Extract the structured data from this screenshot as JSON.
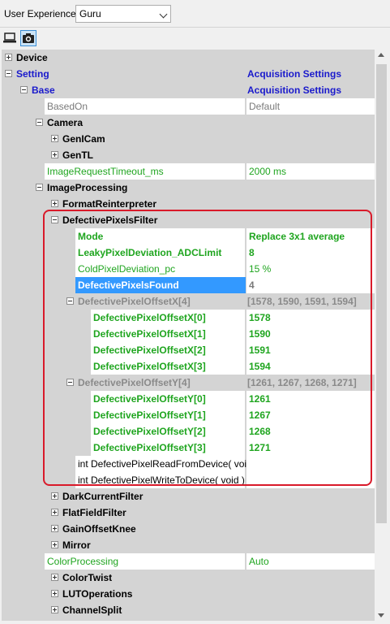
{
  "toolbar": {
    "user_experience_label": "User Experience:",
    "user_experience_value": "Guru"
  },
  "tabs": [
    {
      "icon": "laptop-icon"
    },
    {
      "icon": "camera-icon",
      "active": true
    }
  ],
  "rows": [
    {
      "name": "Device",
      "value": "",
      "indent": 0,
      "exp": "plus",
      "style": "bold"
    },
    {
      "name": "Setting",
      "value": "Acquisition Settings",
      "indent": 0,
      "exp": "minus",
      "style": "grouptitle"
    },
    {
      "name": "Base",
      "value": "Acquisition Settings",
      "indent": 1,
      "exp": "minus",
      "style": "grouptitle"
    },
    {
      "name": "BasedOn",
      "value": "Default",
      "indent": 2,
      "exp": "",
      "style": "white",
      "nameColor": "#7a7a7a",
      "valueColor": "#7a7a7a"
    },
    {
      "name": "Camera",
      "value": "",
      "indent": 2,
      "exp": "minus",
      "style": "bold"
    },
    {
      "name": "GenICam",
      "value": "",
      "indent": 3,
      "exp": "plus",
      "style": "bold"
    },
    {
      "name": "GenTL",
      "value": "",
      "indent": 3,
      "exp": "plus",
      "style": "bold"
    },
    {
      "name": "ImageRequestTimeout_ms",
      "value": "2000 ms",
      "indent": 2,
      "exp": "",
      "style": "white",
      "nameColor": "#1fa51f",
      "valueColor": "#1fa51f"
    },
    {
      "name": "ImageProcessing",
      "value": "",
      "indent": 2,
      "exp": "minus",
      "style": "bold"
    },
    {
      "name": "FormatReinterpreter",
      "value": "",
      "indent": 3,
      "exp": "plus",
      "style": "bold"
    },
    {
      "name": "DefectivePixelsFilter",
      "value": "",
      "indent": 3,
      "exp": "minus",
      "style": "bold"
    },
    {
      "name": "Mode",
      "value": "Replace 3x1 average",
      "indent": 4,
      "exp": "",
      "style": "white bold",
      "nameColor": "#1fa51f",
      "valueColor": "#1fa51f"
    },
    {
      "name": "LeakyPixelDeviation_ADCLimit",
      "value": "8",
      "indent": 4,
      "exp": "",
      "style": "white bold",
      "nameColor": "#1fa51f",
      "valueColor": "#1fa51f"
    },
    {
      "name": "ColdPixelDeviation_pc",
      "value": "15 %",
      "indent": 4,
      "exp": "",
      "style": "white",
      "nameColor": "#1fa51f",
      "valueColor": "#1fa51f"
    },
    {
      "name": "DefectivePixelsFound",
      "value": "4",
      "indent": 4,
      "exp": "",
      "style": "selected bold",
      "valueColor": "#7a7a7a"
    },
    {
      "name": "DefectivePixelOffsetX[4]",
      "value": "[1578, 1590, 1591, 1594]",
      "indent": 4,
      "exp": "minus",
      "style": "bold",
      "nameColor": "#8a8a8a",
      "valueColor": "#8a8a8a"
    },
    {
      "name": "DefectivePixelOffsetX[0]",
      "value": "1578",
      "indent": 5,
      "exp": "",
      "style": "white bold",
      "nameColor": "#1fa51f",
      "valueColor": "#1fa51f"
    },
    {
      "name": "DefectivePixelOffsetX[1]",
      "value": "1590",
      "indent": 5,
      "exp": "",
      "style": "white bold",
      "nameColor": "#1fa51f",
      "valueColor": "#1fa51f"
    },
    {
      "name": "DefectivePixelOffsetX[2]",
      "value": "1591",
      "indent": 5,
      "exp": "",
      "style": "white bold",
      "nameColor": "#1fa51f",
      "valueColor": "#1fa51f"
    },
    {
      "name": "DefectivePixelOffsetX[3]",
      "value": "1594",
      "indent": 5,
      "exp": "",
      "style": "white bold",
      "nameColor": "#1fa51f",
      "valueColor": "#1fa51f"
    },
    {
      "name": "DefectivePixelOffsetY[4]",
      "value": "[1261, 1267, 1268, 1271]",
      "indent": 4,
      "exp": "minus",
      "style": "bold",
      "nameColor": "#8a8a8a",
      "valueColor": "#8a8a8a"
    },
    {
      "name": "DefectivePixelOffsetY[0]",
      "value": "1261",
      "indent": 5,
      "exp": "",
      "style": "white bold",
      "nameColor": "#1fa51f",
      "valueColor": "#1fa51f"
    },
    {
      "name": "DefectivePixelOffsetY[1]",
      "value": "1267",
      "indent": 5,
      "exp": "",
      "style": "white bold",
      "nameColor": "#1fa51f",
      "valueColor": "#1fa51f"
    },
    {
      "name": "DefectivePixelOffsetY[2]",
      "value": "1268",
      "indent": 5,
      "exp": "",
      "style": "white bold",
      "nameColor": "#1fa51f",
      "valueColor": "#1fa51f"
    },
    {
      "name": "DefectivePixelOffsetY[3]",
      "value": "1271",
      "indent": 5,
      "exp": "",
      "style": "white bold",
      "nameColor": "#1fa51f",
      "valueColor": "#1fa51f"
    },
    {
      "name": "int DefectivePixelReadFromDevice( void )",
      "value": "",
      "indent": 4,
      "exp": "",
      "style": "white"
    },
    {
      "name": "int DefectivePixelWriteToDevice( void )",
      "value": "",
      "indent": 4,
      "exp": "",
      "style": "white"
    },
    {
      "name": "DarkCurrentFilter",
      "value": "",
      "indent": 3,
      "exp": "plus",
      "style": "bold"
    },
    {
      "name": "FlatFieldFilter",
      "value": "",
      "indent": 3,
      "exp": "plus",
      "style": "bold"
    },
    {
      "name": "GainOffsetKnee",
      "value": "",
      "indent": 3,
      "exp": "plus",
      "style": "bold"
    },
    {
      "name": "Mirror",
      "value": "",
      "indent": 3,
      "exp": "plus",
      "style": "bold"
    },
    {
      "name": "ColorProcessing",
      "value": "Auto",
      "indent": 2,
      "exp": "",
      "style": "white",
      "nameColor": "#1fa51f",
      "valueColor": "#1fa51f"
    },
    {
      "name": "ColorTwist",
      "value": "",
      "indent": 3,
      "exp": "plus",
      "style": "bold"
    },
    {
      "name": "LUTOperations",
      "value": "",
      "indent": 3,
      "exp": "plus",
      "style": "bold"
    },
    {
      "name": "ChannelSplit",
      "value": "",
      "indent": 3,
      "exp": "plus",
      "style": "bold"
    }
  ],
  "colors": {
    "selected_bg": "#3399ff",
    "highlight_border": "#d91a2a",
    "group_blue": "#1a1acc",
    "param_green": "#1fa51f"
  }
}
